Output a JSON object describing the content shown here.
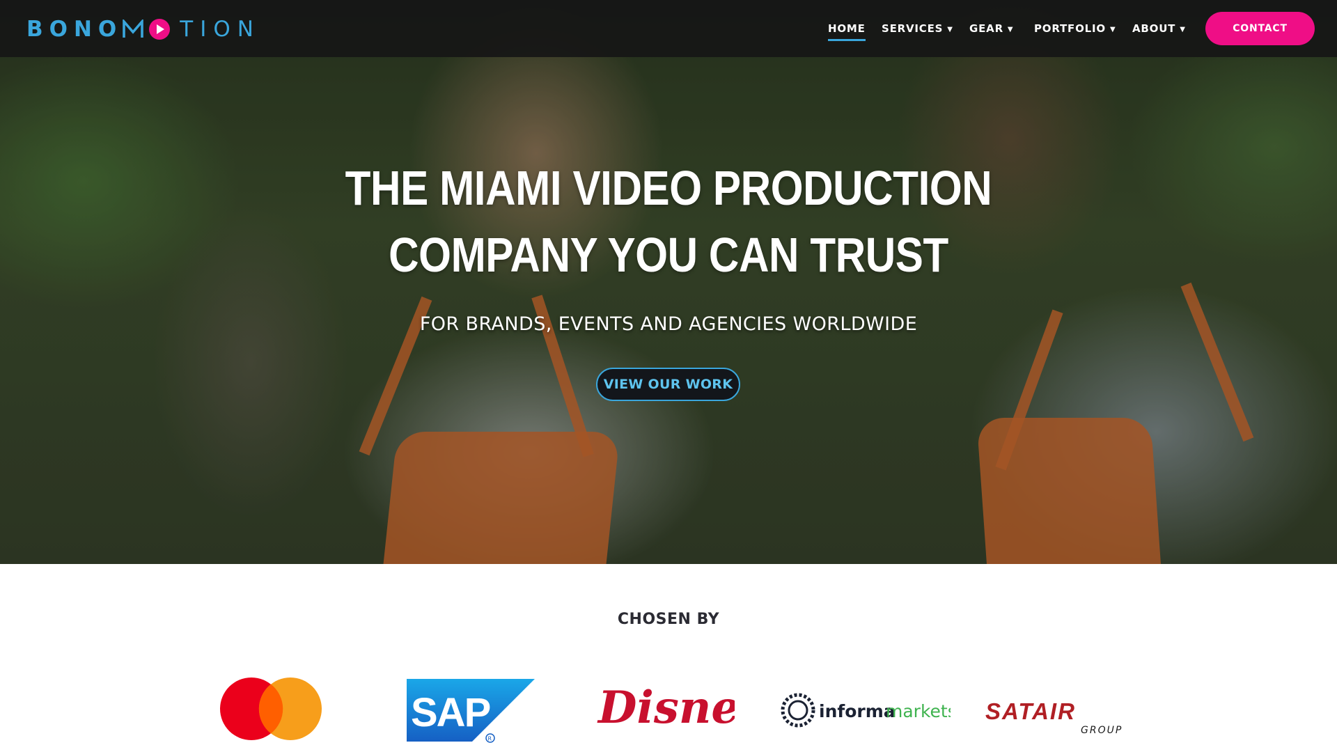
{
  "header": {
    "logo": {
      "part1": "BONO",
      "part2": "TION"
    },
    "nav": [
      {
        "label": "HOME",
        "has_dropdown": false,
        "active": true
      },
      {
        "label": "SERVICES",
        "has_dropdown": true
      },
      {
        "label": "GEAR",
        "has_dropdown": true
      },
      {
        "label": "PORTFOLIO",
        "has_dropdown": true
      },
      {
        "label": "ABOUT",
        "has_dropdown": true
      }
    ],
    "contact_label": "CONTACT"
  },
  "hero": {
    "title_line1": "THE MIAMI VIDEO PRODUCTION",
    "title_line2": "COMPANY YOU CAN TRUST",
    "subtitle": "FOR BRANDS, EVENTS AND AGENCIES WORLDWIDE",
    "cta_label": "VIEW OUR WORK"
  },
  "clients": {
    "heading": "CHOSEN BY",
    "logos": [
      {
        "name": "Mastercard",
        "text": ""
      },
      {
        "name": "SAP",
        "text": "SAP"
      },
      {
        "name": "Disney",
        "text": "Disney"
      },
      {
        "name": "informa markets",
        "text_a": "informa",
        "text_b": "markets"
      },
      {
        "name": "Satair Group",
        "text_a": "SATAIR",
        "text_b": "GROUP"
      }
    ]
  },
  "colors": {
    "brand_blue": "#3aa6dc",
    "brand_pink": "#ef0e86",
    "header_bg": "#161616",
    "mastercard_red": "#eb001b",
    "mastercard_orange": "#f79e1b",
    "sap_blue": "#1a6fd1",
    "disney_red": "#c8102e",
    "informa_green": "#3fb34f",
    "satair_red": "#b01f24"
  },
  "icons": {
    "dropdown": "chevron-down-icon",
    "logo_play": "play-icon"
  }
}
